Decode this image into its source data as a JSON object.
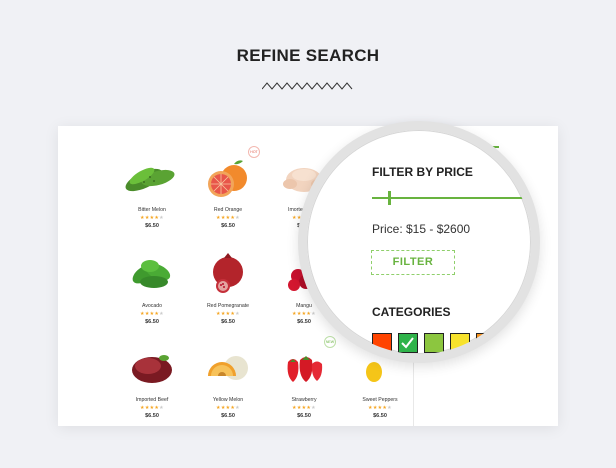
{
  "heading": "REFINE SEARCH",
  "products": [
    {
      "name": "Bitter Melon",
      "price": "$6.50",
      "rating": 4,
      "badge": ""
    },
    {
      "name": "Red Orange",
      "price": "$6.50",
      "rating": 4,
      "badge": "HOT"
    },
    {
      "name": "Imorted Chick",
      "price": "$6.50",
      "rating": 4,
      "badge": ""
    },
    {
      "name": "Avocado",
      "price": "$6.50",
      "rating": 4,
      "badge": ""
    },
    {
      "name": "Red Pomegranate",
      "price": "$6.50",
      "rating": 4,
      "badge": ""
    },
    {
      "name": "Mangu",
      "price": "$6.50",
      "rating": 4,
      "badge": ""
    },
    {
      "name": "Imported Beef",
      "price": "$6.50",
      "rating": 4,
      "badge": ""
    },
    {
      "name": "Yellow Melon",
      "price": "$6.50",
      "rating": 4,
      "badge": ""
    },
    {
      "name": "Strawberry",
      "price": "$6.50",
      "rating": 4,
      "badge": "NEW"
    },
    {
      "name": "Sweet Peppers",
      "price": "$6.50",
      "rating": 4,
      "badge": ""
    }
  ],
  "sidebar": {
    "mini_title": "FILTER BY PRICE"
  },
  "magnifier": {
    "filter_title": "FILTER BY PRICE",
    "price_text": "Price: $15 - $2600",
    "filter_button": "FILTER",
    "categories_title": "CATEGORIES",
    "swatches": [
      {
        "color": "#ff4400",
        "checked": false
      },
      {
        "color": "#2fb34a",
        "checked": true
      },
      {
        "color": "#8cc63f",
        "checked": false
      },
      {
        "color": "#f7e22c",
        "checked": false
      },
      {
        "color": "#f7931e",
        "checked": false
      },
      {
        "color": "#7b2a9c",
        "checked": false
      },
      {
        "color": "#000000",
        "checked": false
      },
      {
        "color": "#b3b3b3",
        "checked": false
      },
      {
        "color": "#ffffff",
        "checked": false
      }
    ]
  },
  "colors": {
    "accent": "#68b33f",
    "star": "#f5a623"
  }
}
